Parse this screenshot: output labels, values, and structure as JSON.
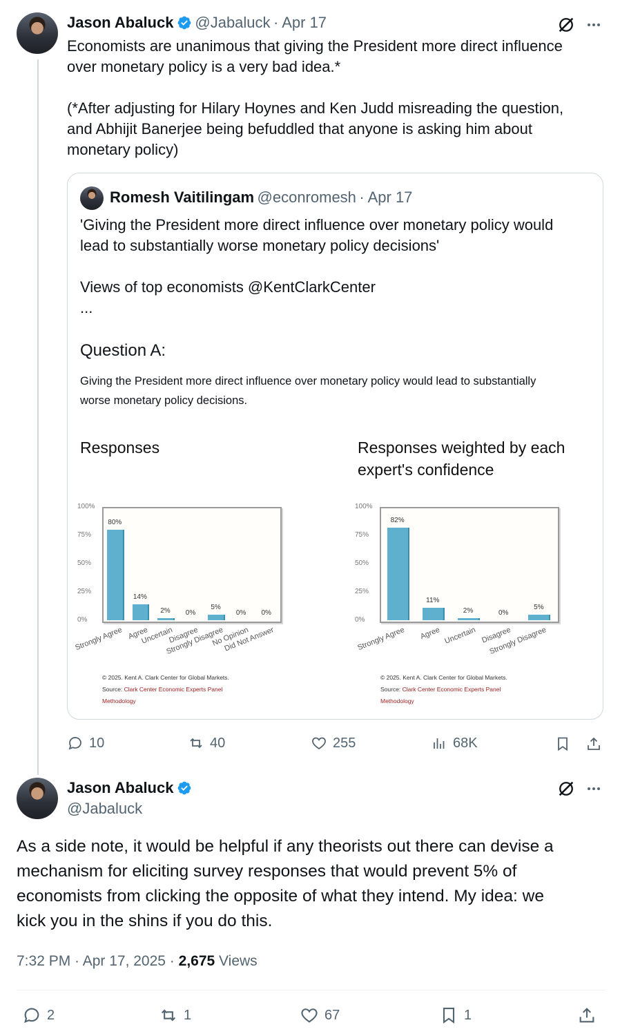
{
  "tweet1": {
    "author_name": "Jason Abaluck",
    "handle": "@Jabaluck",
    "date": "· Apr 17",
    "text_line1": "Economists are unanimous that giving the President more direct influence",
    "text_line2": "over monetary policy is a very bad idea.*",
    "text_line3": "(*After adjusting for Hilary Hoynes and Ken Judd misreading the question,",
    "text_line4": "and Abhijit Banerjee being befuddled that anyone is asking him about",
    "text_line5": "monetary policy)",
    "quote": {
      "author_name": "Romesh Vaitilingam",
      "handle": "@econromesh",
      "date": "· Apr 17",
      "text_line1": "'Giving the President more direct influence over monetary policy would",
      "text_line2": "lead to substantially worse monetary policy decisions'",
      "text_line3": "Views of top economists @KentClarkCenter",
      "text_line4": "...",
      "question_heading": "Question A:",
      "question_line1": "Giving the President more direct influence over monetary policy would lead to substantially",
      "question_line2": "worse monetary policy decisions.",
      "copyright": "© 2025. Kent A. Clark Center for Global Markets.",
      "source_label": "Source: ",
      "source_link": "Clark Center Economic Experts Panel",
      "methodology": "Methodology"
    },
    "actions": {
      "replies": "10",
      "reposts": "40",
      "likes": "255",
      "views": "68K"
    }
  },
  "tweet2": {
    "author_name": "Jason Abaluck",
    "handle": "@Jabaluck",
    "text_line1": "As a side note, it would be helpful if any theorists out there can devise a",
    "text_line2": "mechanism for eliciting survey responses that would prevent 5% of",
    "text_line3": "economists from clicking the opposite of what they intend. My idea: we",
    "text_line4": "kick you in the shins if you do this.",
    "time": "7:32 PM · Apr 17, 2025 · ",
    "views_count": "2,675",
    "views_label": " Views",
    "actions": {
      "replies": "2",
      "reposts": "1",
      "likes": "67",
      "bookmarks": "1"
    }
  },
  "colors": {
    "verified": "#1d9bf0",
    "bar": "#5fb0cf",
    "muted": "#536471"
  },
  "chart_data": [
    {
      "type": "bar",
      "title": "Responses",
      "categories": [
        "Strongly Agree",
        "Agree",
        "Uncertain",
        "Disagree",
        "Strongly Disagree",
        "No Opinion",
        "Did Not Answer"
      ],
      "values": [
        80,
        14,
        2,
        0,
        5,
        0,
        0
      ],
      "value_labels": [
        "80%",
        "14%",
        "2%",
        "0%",
        "5%",
        "0%",
        "0%"
      ],
      "yticks": [
        "100%",
        "75%",
        "50%",
        "25%",
        "0%"
      ],
      "ylim": [
        0,
        100
      ]
    },
    {
      "type": "bar",
      "title": "Responses weighted by each expert's confidence",
      "title_line1": "Responses weighted by each",
      "title_line2": "expert's confidence",
      "categories": [
        "Strongly Agree",
        "Agree",
        "Uncertain",
        "Disagree",
        "Strongly Disagree"
      ],
      "values": [
        82,
        11,
        2,
        0,
        5
      ],
      "value_labels": [
        "82%",
        "11%",
        "2%",
        "0%",
        "5%"
      ],
      "yticks": [
        "100%",
        "75%",
        "50%",
        "25%",
        "0%"
      ],
      "ylim": [
        0,
        100
      ]
    }
  ]
}
